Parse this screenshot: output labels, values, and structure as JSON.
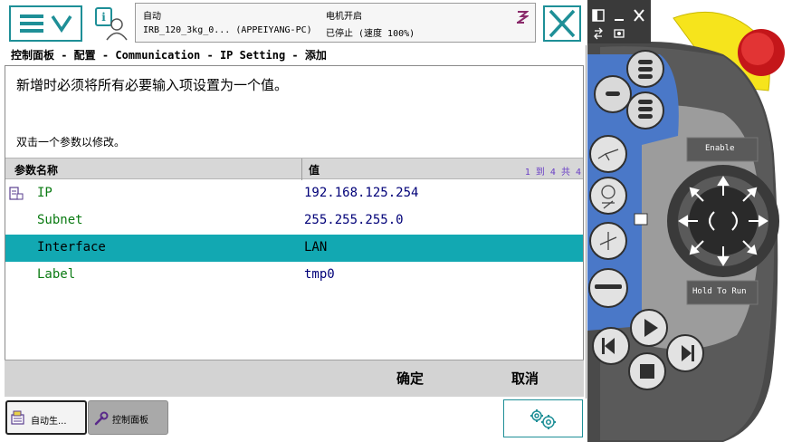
{
  "topbar": {
    "status_mode": "自动",
    "status_system": "IRB_120_3kg_0...  (APPEIYANG-PC)",
    "status_motor": "电机开启",
    "status_state": "已停止 (速度 100%)"
  },
  "breadcrumb": "控制面板 - 配置 - Communication - IP Setting - 添加",
  "panel": {
    "message": "新增时必须将所有必要输入项设置为一个值。",
    "hint": "双击一个参数以修改。"
  },
  "table": {
    "headers": [
      "参数名称",
      "值"
    ],
    "pager": "1 到 4 共 4",
    "rows": [
      {
        "name": "IP",
        "value": "192.168.125.254",
        "selected": false
      },
      {
        "name": "Subnet",
        "value": "255.255.255.0",
        "selected": false
      },
      {
        "name": "Interface",
        "value": "LAN",
        "selected": true
      },
      {
        "name": "Label",
        "value": "tmp0",
        "selected": false
      }
    ]
  },
  "actions": {
    "ok": "确定",
    "cancel": "取消"
  },
  "taskbar": {
    "task1": "自动生...",
    "task2": "控制面板"
  },
  "pendant": {
    "enable": "Enable",
    "hold_to_run": "Hold To Run"
  },
  "colors": {
    "accent": "#1e8f97",
    "selection": "#12a8b2",
    "param_name": "#0a7a12",
    "param_value": "#000078",
    "pendant_blue": "#4a78c8",
    "emergency_red": "#d51a1a",
    "body_yellow": "#f6e41c"
  },
  "icons": [
    "menu-icon",
    "chevron-down-icon",
    "info-user-icon",
    "robot-arm-icon",
    "close-icon",
    "parameter-icon",
    "auto-program-icon",
    "wrench-icon",
    "gears-icon"
  ]
}
